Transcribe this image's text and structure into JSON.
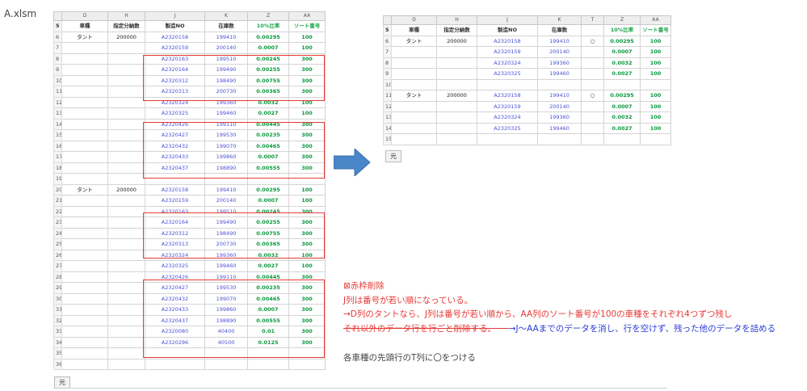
{
  "file_title": "A.xlsm",
  "sheet_tab": "元",
  "left_table": {
    "columns": [
      "D",
      "H",
      "J",
      "K",
      "Z",
      "AA"
    ],
    "header": {
      "row": "5",
      "cells": [
        "車種",
        "指定分納数",
        "製造NO",
        "在庫数",
        "10%比率",
        "ソート番号"
      ]
    },
    "rows": [
      {
        "r": "6",
        "cells": [
          "タント",
          "200000",
          "A2320158",
          "199410",
          "0.00295",
          "100"
        ]
      },
      {
        "r": "7",
        "cells": [
          "",
          "",
          "A2320159",
          "200140",
          "0.0007",
          "100"
        ]
      },
      {
        "r": "8",
        "cells": [
          "",
          "",
          "A2320163",
          "199510",
          "0.00245",
          "300"
        ]
      },
      {
        "r": "9",
        "cells": [
          "",
          "",
          "A2320164",
          "199490",
          "0.00255",
          "300"
        ]
      },
      {
        "r": "10",
        "cells": [
          "",
          "",
          "A2320312",
          "198490",
          "0.00755",
          "300"
        ]
      },
      {
        "r": "11",
        "cells": [
          "",
          "",
          "A2320313",
          "200730",
          "0.00365",
          "300"
        ]
      },
      {
        "r": "12",
        "cells": [
          "",
          "",
          "A2320324",
          "199360",
          "0.0032",
          "100"
        ]
      },
      {
        "r": "13",
        "cells": [
          "",
          "",
          "A2320325",
          "199460",
          "0.0027",
          "100"
        ]
      },
      {
        "r": "14",
        "cells": [
          "",
          "",
          "A2320426",
          "199110",
          "0.00445",
          "300"
        ]
      },
      {
        "r": "15",
        "cells": [
          "",
          "",
          "A2320427",
          "199530",
          "0.00235",
          "300"
        ]
      },
      {
        "r": "16",
        "cells": [
          "",
          "",
          "A2320432",
          "199070",
          "0.00465",
          "300"
        ]
      },
      {
        "r": "17",
        "cells": [
          "",
          "",
          "A2320433",
          "199860",
          "0.0007",
          "300"
        ]
      },
      {
        "r": "18",
        "cells": [
          "",
          "",
          "A2320437",
          "198890",
          "0.00555",
          "300"
        ]
      },
      {
        "r": "19",
        "cells": [
          "",
          "",
          "",
          "",
          "",
          ""
        ]
      },
      {
        "r": "20",
        "cells": [
          "タント",
          "200000",
          "A2320158",
          "199410",
          "0.00295",
          "100"
        ]
      },
      {
        "r": "21",
        "cells": [
          "",
          "",
          "A2320159",
          "200140",
          "0.0007",
          "100"
        ]
      },
      {
        "r": "22",
        "cells": [
          "",
          "",
          "A2320163",
          "199510",
          "0.00245",
          "300"
        ]
      },
      {
        "r": "23",
        "cells": [
          "",
          "",
          "A2320164",
          "199490",
          "0.00255",
          "300"
        ]
      },
      {
        "r": "24",
        "cells": [
          "",
          "",
          "A2320312",
          "198490",
          "0.00755",
          "300"
        ]
      },
      {
        "r": "25",
        "cells": [
          "",
          "",
          "A2320313",
          "200730",
          "0.00365",
          "300"
        ]
      },
      {
        "r": "26",
        "cells": [
          "",
          "",
          "A2320324",
          "199360",
          "0.0032",
          "100"
        ]
      },
      {
        "r": "27",
        "cells": [
          "",
          "",
          "A2320325",
          "199460",
          "0.0027",
          "100"
        ]
      },
      {
        "r": "28",
        "cells": [
          "",
          "",
          "A2320426",
          "199110",
          "0.00445",
          "300"
        ]
      },
      {
        "r": "29",
        "cells": [
          "",
          "",
          "A2320427",
          "199530",
          "0.00235",
          "300"
        ]
      },
      {
        "r": "30",
        "cells": [
          "",
          "",
          "A2320432",
          "199070",
          "0.00465",
          "300"
        ]
      },
      {
        "r": "31",
        "cells": [
          "",
          "",
          "A2320433",
          "199860",
          "0.0007",
          "300"
        ]
      },
      {
        "r": "32",
        "cells": [
          "",
          "",
          "A2320437",
          "198890",
          "0.00555",
          "300"
        ]
      },
      {
        "r": "33",
        "cells": [
          "",
          "",
          "A2320080",
          "40400",
          "0.01",
          "300"
        ]
      },
      {
        "r": "34",
        "cells": [
          "",
          "",
          "A2320296",
          "40500",
          "0.0125",
          "300"
        ]
      },
      {
        "r": "35",
        "cells": [
          "",
          "",
          "",
          "",
          "",
          ""
        ]
      },
      {
        "r": "36",
        "cells": [
          "",
          "",
          "",
          "",
          "",
          ""
        ]
      }
    ]
  },
  "right_table": {
    "columns": [
      "D",
      "H",
      "J",
      "K",
      "T",
      "Z",
      "AA"
    ],
    "header": {
      "row": "5",
      "cells": [
        "車種",
        "指定分納数",
        "製造NO",
        "在庫数",
        "",
        "10%比率",
        "ソート番号"
      ]
    },
    "rows": [
      {
        "r": "6",
        "cells": [
          "タント",
          "200000",
          "A2320158",
          "199410",
          "○",
          "0.00295",
          "100"
        ]
      },
      {
        "r": "7",
        "cells": [
          "",
          "",
          "A2320159",
          "200140",
          "",
          "0.0007",
          "100"
        ]
      },
      {
        "r": "8",
        "cells": [
          "",
          "",
          "A2320324",
          "199360",
          "",
          "0.0032",
          "100"
        ]
      },
      {
        "r": "9",
        "cells": [
          "",
          "",
          "A2320325",
          "199460",
          "",
          "0.0027",
          "100"
        ]
      },
      {
        "r": "10",
        "cells": [
          "",
          "",
          "",
          "",
          "",
          "",
          ""
        ]
      },
      {
        "r": "11",
        "cells": [
          "タント",
          "200000",
          "A2320158",
          "199410",
          "○",
          "0.00295",
          "100"
        ]
      },
      {
        "r": "12",
        "cells": [
          "",
          "",
          "A2320159",
          "200140",
          "",
          "0.0007",
          "100"
        ]
      },
      {
        "r": "13",
        "cells": [
          "",
          "",
          "A2320324",
          "199360",
          "",
          "0.0032",
          "100"
        ]
      },
      {
        "r": "14",
        "cells": [
          "",
          "",
          "A2320325",
          "199460",
          "",
          "0.0027",
          "100"
        ]
      },
      {
        "r": "15",
        "cells": [
          "",
          "",
          "",
          "",
          "",
          "",
          ""
        ]
      }
    ]
  },
  "notes": {
    "line1": "⊠赤枠削除",
    "line2": "J列は番号が若い順になっている。",
    "line3": "→D列のタントなら、J列は番号が若い順から、AA列のソート番号が100の車種をそれぞれ4つずつ残し",
    "line4_strike": "それ以外のデータ行を行ごと削除する。",
    "line4_blue": "→J～AAまでのデータを消し、行を空けず、残った他のデータを詰める",
    "line5": "各車種の先頭行のT列に〇をつける"
  },
  "colors": {
    "accent_red": "#e53935",
    "number_blue": "#4b52d6",
    "number_green": "#0a9a3e",
    "note_blue": "#2a3bd6",
    "arrow_blue": "#4a86c8"
  }
}
